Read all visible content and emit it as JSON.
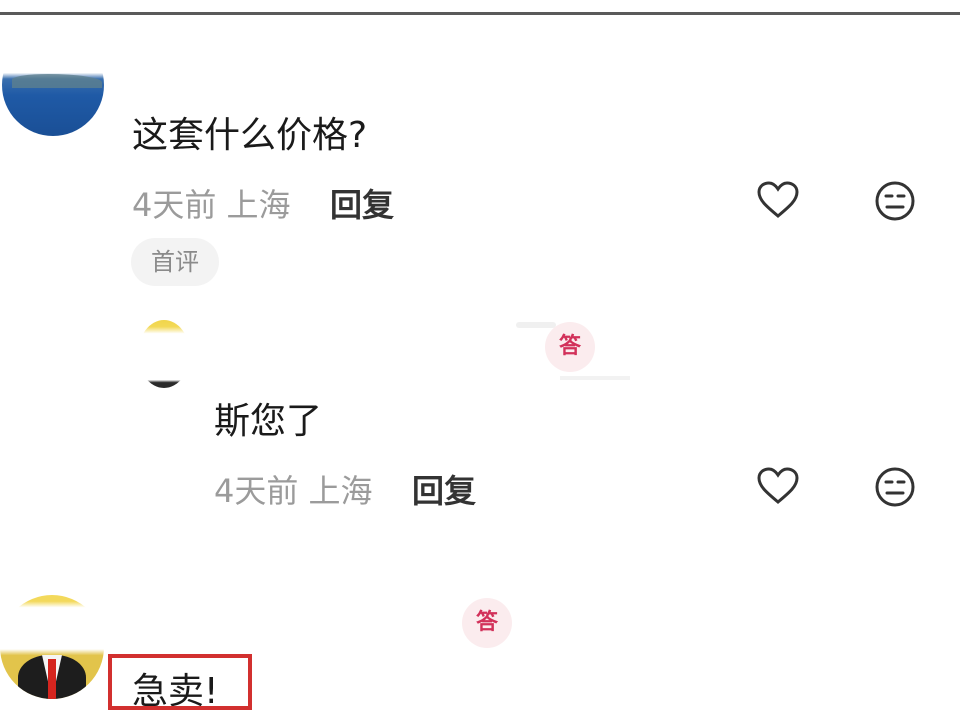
{
  "comments": [
    {
      "text": "这套什么价格?",
      "time": "4天前",
      "location": "上海",
      "reply_label": "回复",
      "badge": "首评"
    },
    {
      "text": "斯您了",
      "time": "4天前",
      "location": "上海",
      "reply_label": "回复"
    },
    {
      "text": "急卖!"
    }
  ],
  "tag_fragment": "答",
  "icons": {
    "like": "heart-outline-icon",
    "dislike": "neutral-face-icon"
  },
  "colors": {
    "meta_text": "#9b9b9b",
    "highlight_border": "#d2302f",
    "tag_text": "#d2315a"
  }
}
